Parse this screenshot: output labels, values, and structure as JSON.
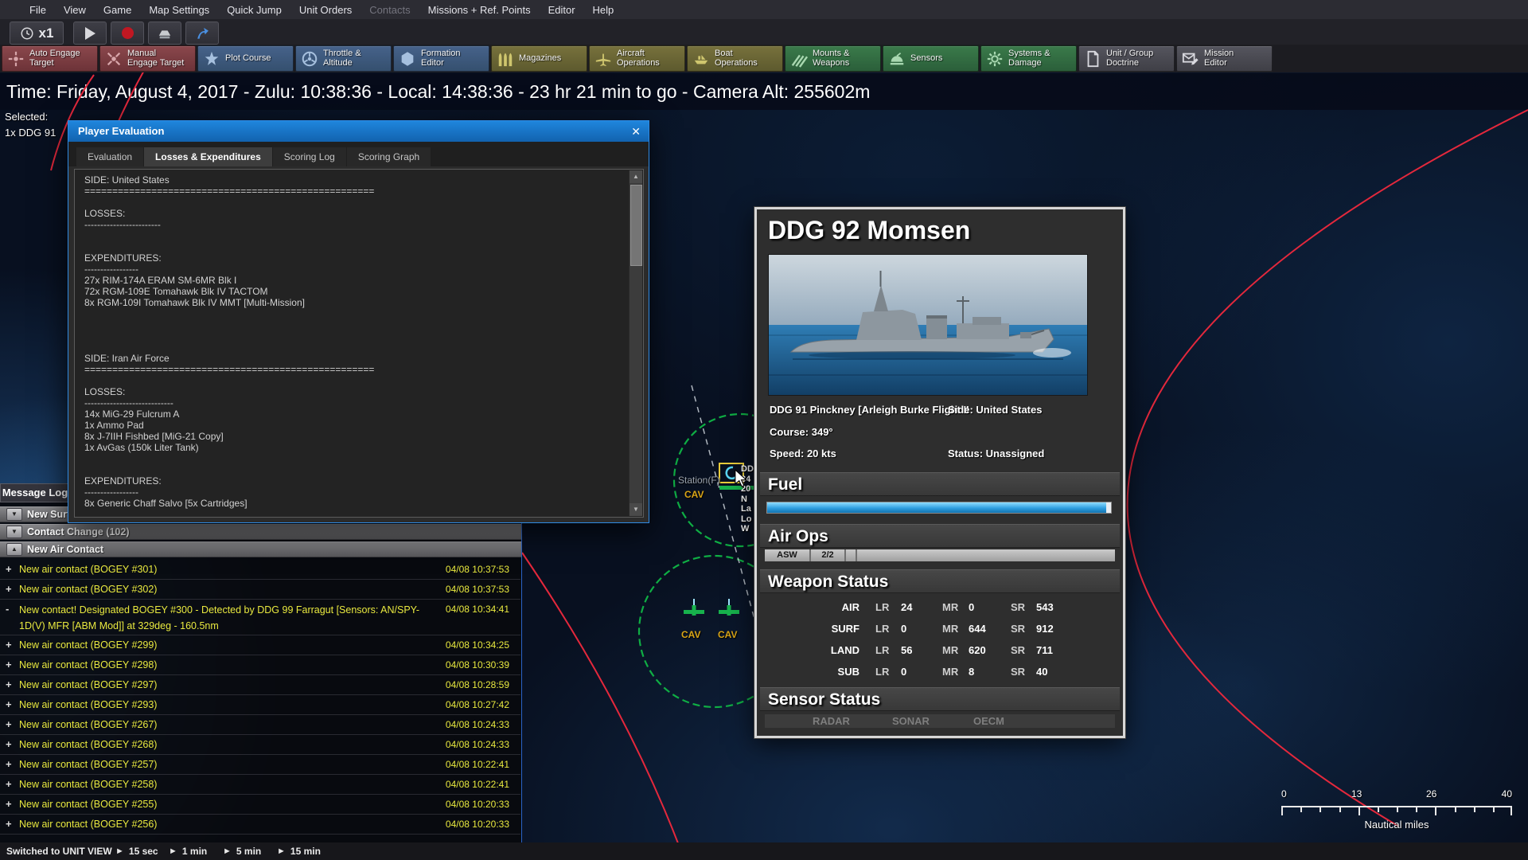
{
  "menu_bar": {
    "items": [
      "File",
      "View",
      "Game",
      "Map Settings",
      "Quick Jump",
      "Unit Orders",
      "Contacts",
      "Missions + Ref. Points",
      "Editor",
      "Help"
    ]
  },
  "time_controls": {
    "speed_label": "x1"
  },
  "toolbar": {
    "buttons": [
      {
        "line1": "Auto Engage",
        "line2": "Target"
      },
      {
        "line1": "Manual",
        "line2": "Engage Target"
      },
      {
        "line1": "Plot Course",
        "line2": ""
      },
      {
        "line1": "Throttle &",
        "line2": "Altitude"
      },
      {
        "line1": "Formation",
        "line2": "Editor"
      },
      {
        "line1": "Magazines",
        "line2": ""
      },
      {
        "line1": "Aircraft",
        "line2": "Operations"
      },
      {
        "line1": "Boat",
        "line2": "Operations"
      },
      {
        "line1": "Mounts &",
        "line2": "Weapons"
      },
      {
        "line1": "Sensors",
        "line2": ""
      },
      {
        "line1": "Systems &",
        "line2": "Damage"
      },
      {
        "line1": "Unit / Group",
        "line2": "Doctrine"
      },
      {
        "line1": "Mission",
        "line2": "Editor"
      }
    ]
  },
  "status_bar": {
    "time_line": "Time: Friday, August 4, 2017 - Zulu: 10:38:36 - Local: 14:38:36 - 23 hr 21 min to go -  Camera Alt: 255602m",
    "selected_label": "Selected:",
    "selected_value": "1x DDG 91"
  },
  "evaluation_dialog": {
    "title": "Player Evaluation",
    "close_glyph": "✕",
    "tabs": [
      "Evaluation",
      "Losses & Expenditures",
      "Scoring Log",
      "Scoring Graph"
    ],
    "active_tab": "Losses & Expenditures",
    "scroll_up_glyph": "▲",
    "scroll_down_glyph": "▼",
    "content": "SIDE: United States\n====================================================\n\nLOSSES:\n------------------------\n\n\nEXPENDITURES:\n-----------------\n27x RIM-174A ERAM SM-6MR Blk I\n72x RGM-109E Tomahawk Blk IV TACTOM\n8x RGM-109I Tomahawk Blk IV MMT [Multi-Mission]\n\n\n\n\nSIDE: Iran Air Force\n====================================================\n\nLOSSES:\n----------------------------\n14x MiG-29 Fulcrum A\n1x Ammo Pad\n8x J-7IIH Fishbed [MiG-21 Copy]\n1x AvGas (150k Liter Tank)\n\n\nEXPENDITURES:\n-----------------\n8x Generic Chaff Salvo [5x Cartridges]"
  },
  "message_log": {
    "title": "Message Log",
    "groups": [
      {
        "label": "New Surface Contact",
        "arrow": "▼"
      },
      {
        "label": "Contact Change (102)",
        "arrow": "▼"
      },
      {
        "label": "New Air Contact",
        "arrow": "▲"
      }
    ],
    "entries": [
      {
        "prefix": "+",
        "text": "New air contact (BOGEY #301)",
        "time": "04/08 10:37:53"
      },
      {
        "prefix": "+",
        "text": "New air contact (BOGEY #302)",
        "time": "04/08 10:37:53"
      },
      {
        "prefix": "-",
        "text": "New contact! Designated BOGEY #300 - Detected by DDG 99 Farragut  [Sensors: AN/SPY-1D(V) MFR [ABM Mod]] at 329deg - 160.5nm",
        "time": "04/08 10:34:41"
      },
      {
        "prefix": "+",
        "text": "New air contact (BOGEY #299)",
        "time": "04/08 10:34:25"
      },
      {
        "prefix": "+",
        "text": "New air contact (BOGEY #298)",
        "time": "04/08 10:30:39"
      },
      {
        "prefix": "+",
        "text": "New air contact (BOGEY #297)",
        "time": "04/08 10:28:59"
      },
      {
        "prefix": "+",
        "text": "New air contact (BOGEY #293)",
        "time": "04/08 10:27:42"
      },
      {
        "prefix": "+",
        "text": "New air contact (BOGEY #267)",
        "time": "04/08 10:24:33"
      },
      {
        "prefix": "+",
        "text": "New air contact (BOGEY #268)",
        "time": "04/08 10:24:33"
      },
      {
        "prefix": "+",
        "text": "New air contact (BOGEY #257)",
        "time": "04/08 10:22:41"
      },
      {
        "prefix": "+",
        "text": "New air contact (BOGEY #258)",
        "time": "04/08 10:22:41"
      },
      {
        "prefix": "+",
        "text": "New air contact (BOGEY #255)",
        "time": "04/08 10:20:33"
      },
      {
        "prefix": "+",
        "text": "New air contact (BOGEY #256)",
        "time": "04/08 10:20:33"
      }
    ]
  },
  "unit_panel": {
    "title": "DDG 92 Momsen",
    "class_line": "DDG 91 Pinckney [Arleigh Burke Flight II",
    "side": "Side: United States",
    "course": "Course: 349°",
    "speed": "Speed: 20 kts",
    "status": "Status: Unassigned",
    "sections": {
      "fuel": "Fuel",
      "air_ops": "Air Ops",
      "weapon_status": "Weapon Status",
      "sensor_status": "Sensor Status"
    },
    "fuel_percent": 98.5,
    "air_ops_cells": [
      "ASW",
      "2/2"
    ],
    "weapon_status": {
      "col_labels": [
        "LR",
        "MR",
        "SR"
      ],
      "rows": [
        {
          "cat": "AIR",
          "lr": "24",
          "mr": "0",
          "sr": "543"
        },
        {
          "cat": "SURF",
          "lr": "0",
          "mr": "644",
          "sr": "912"
        },
        {
          "cat": "LAND",
          "lr": "56",
          "mr": "620",
          "sr": "711"
        },
        {
          "cat": "SUB",
          "lr": "0",
          "mr": "8",
          "sr": "40"
        }
      ]
    },
    "sensor_labels": [
      "RADAR",
      "SONAR",
      "OECM"
    ]
  },
  "map": {
    "labels": {
      "station": "Station(F)",
      "cav1": "CAV",
      "cav2": "CAV",
      "cav3": "CAV"
    },
    "unit_readout": [
      "DD",
      "34",
      "20",
      "N",
      "La",
      "Lo",
      "W"
    ],
    "accent_colors": {
      "range_ring_red": "#e4283c",
      "range_ring_green": "#0fae44"
    }
  },
  "scale_bar": {
    "ticks": [
      "0",
      "13",
      "26",
      "40"
    ],
    "unit_label": "Nautical miles"
  },
  "bottom_bar": {
    "status": "Switched to UNIT VIEW",
    "step_glyph": "►",
    "time_steps": [
      "15 sec",
      "1 min",
      "5 min",
      "15 min"
    ]
  }
}
